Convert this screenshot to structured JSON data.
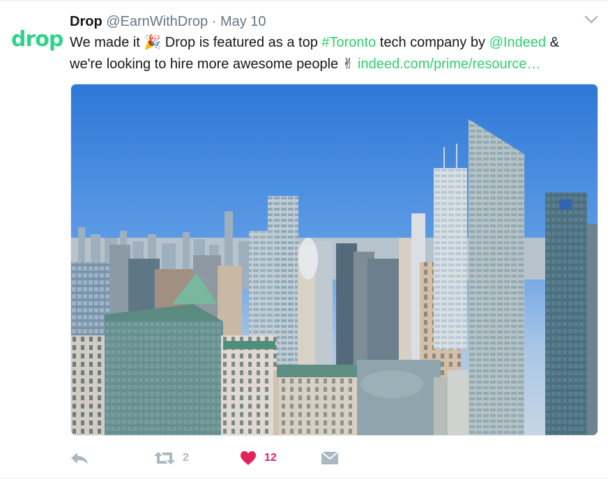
{
  "tweet": {
    "avatar_text": "drop",
    "fullname": "Drop",
    "username": "@EarnWithDrop",
    "separator": "·",
    "time": "May 10",
    "text": {
      "part1": "We made it ",
      "emoji_party": "🎉",
      "part2": " Drop is featured as a top ",
      "hashtag": "#Toronto",
      "part3": " tech company by ",
      "mention": "@Indeed",
      "part4": " & we're looking to hire more awesome people ",
      "emoji_peace": "✌",
      "link": "indeed.com/prime/resource…"
    },
    "media_description_icon": "toronto-skyline-photo"
  },
  "actions": {
    "reply_icon": "reply-icon",
    "retweet_icon": "retweet-icon",
    "retweet_count": "2",
    "like_icon": "heart-icon",
    "like_count": "12",
    "message_icon": "envelope-icon"
  },
  "colors": {
    "accent": "#2fcf6e",
    "brand": "#2fd48a",
    "like": "#e0245e",
    "muted": "#aab8c2",
    "secondary_text": "#657786"
  }
}
